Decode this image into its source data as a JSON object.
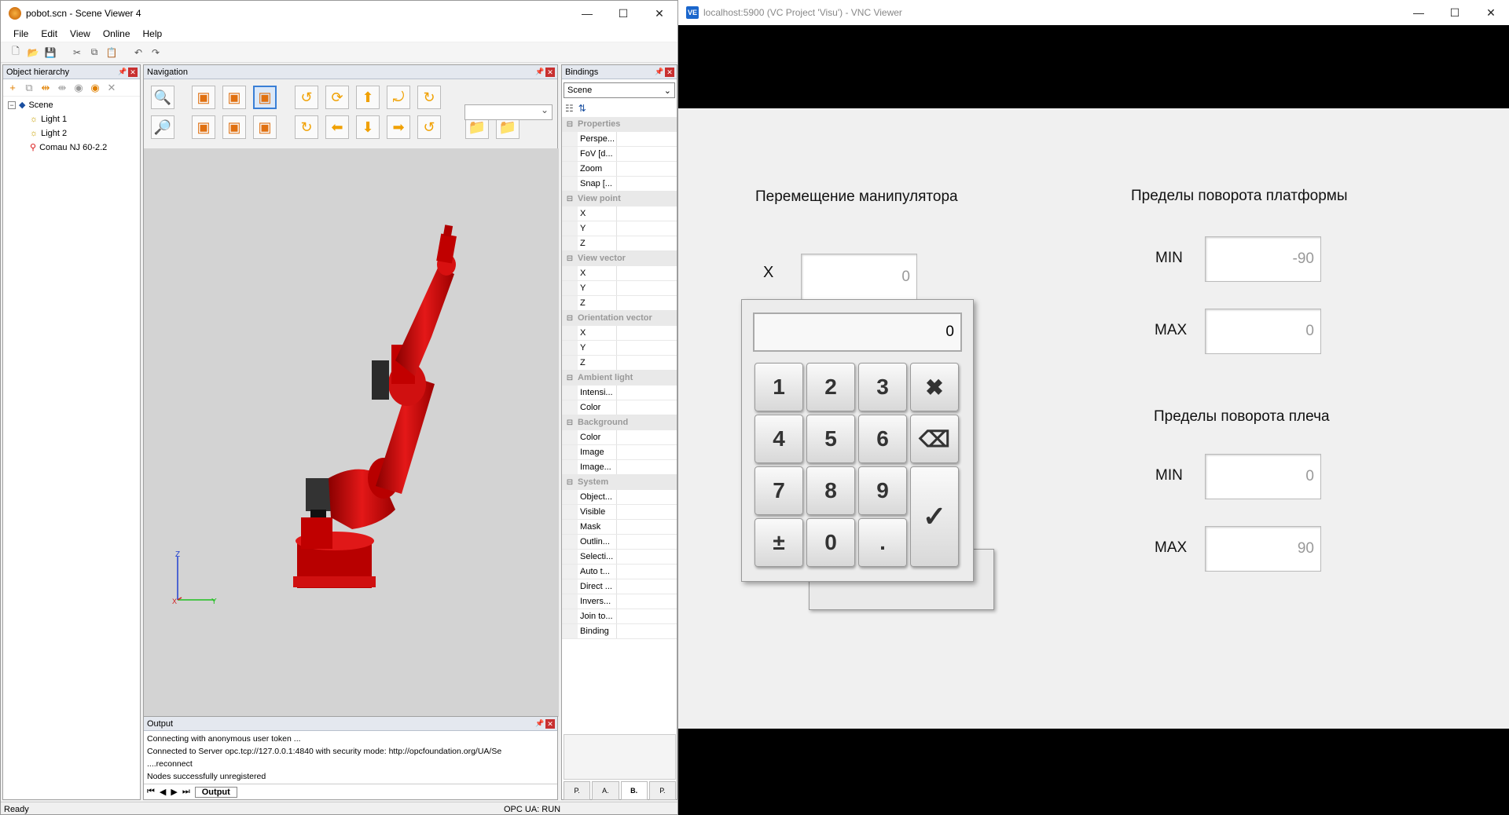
{
  "scene_viewer": {
    "title": "pobot.scn - Scene Viewer 4",
    "menu": [
      "File",
      "Edit",
      "View",
      "Online",
      "Help"
    ],
    "hierarchy": {
      "title": "Object hierarchy",
      "items": [
        "Scene",
        "Light 1",
        "Light 2",
        "Comau NJ 60-2.2"
      ]
    },
    "navigation": {
      "title": "Navigation"
    },
    "bindings": {
      "title": "Bindings",
      "selector": "Scene",
      "categories": [
        {
          "name": "Properties",
          "rows": [
            "Perspe...",
            "FoV [d...",
            "Zoom",
            "Snap [..."
          ]
        },
        {
          "name": "View point",
          "rows": [
            "X",
            "Y",
            "Z"
          ]
        },
        {
          "name": "View vector",
          "rows": [
            "X",
            "Y",
            "Z"
          ]
        },
        {
          "name": "Orientation vector",
          "rows": [
            "X",
            "Y",
            "Z"
          ]
        },
        {
          "name": "Ambient light",
          "rows": [
            "Intensi...",
            "Color"
          ]
        },
        {
          "name": "Background",
          "rows": [
            "Color",
            "Image",
            "Image..."
          ]
        },
        {
          "name": "System",
          "rows": [
            "Object...",
            "Visible",
            "Mask",
            "Outlin...",
            "Selecti...",
            "Auto t...",
            "Direct ...",
            "Invers...",
            "Join to...",
            "Binding"
          ]
        }
      ],
      "tabs": [
        "P.",
        "A.",
        "B.",
        "P."
      ]
    },
    "output": {
      "title": "Output",
      "lines": [
        "Connecting with anonymous user token ...",
        "Connected to Server opc.tcp://127.0.0.1:4840 with security mode: http://opcfoundation.org/UA/Se",
        "....reconnect",
        "Nodes successfully unregistered"
      ],
      "tab": "Output"
    },
    "axes": {
      "z": "Z",
      "y": "Y",
      "x": "X"
    },
    "status": {
      "left": "Ready",
      "right": "OPC UA: RUN"
    }
  },
  "vnc": {
    "title": "localhost:5900 (VC Project 'Visu') - VNC Viewer",
    "icon_text": "VE",
    "hmi": {
      "move_title": "Перемещение манипулятора",
      "x_label": "X",
      "x_value": "0",
      "platform_title": "Пределы поворота платформы",
      "platform_min_label": "MIN",
      "platform_min": "-90",
      "platform_max_label": "MAX",
      "platform_max": "0",
      "shoulder_title": "Пределы поворота плеча",
      "shoulder_min_label": "MIN",
      "shoulder_min": "0",
      "shoulder_max_label": "MAX",
      "shoulder_max": "90"
    },
    "keypad": {
      "display": "0",
      "keys": [
        "1",
        "2",
        "3",
        "✖",
        "4",
        "5",
        "6",
        "⌫",
        "7",
        "8",
        "9",
        "✓",
        "±",
        "0",
        "."
      ]
    }
  },
  "colors": {
    "robot": "#d81010",
    "hmi_bg": "#f0f0f0",
    "viewport_bg": "#d3d3d3"
  }
}
